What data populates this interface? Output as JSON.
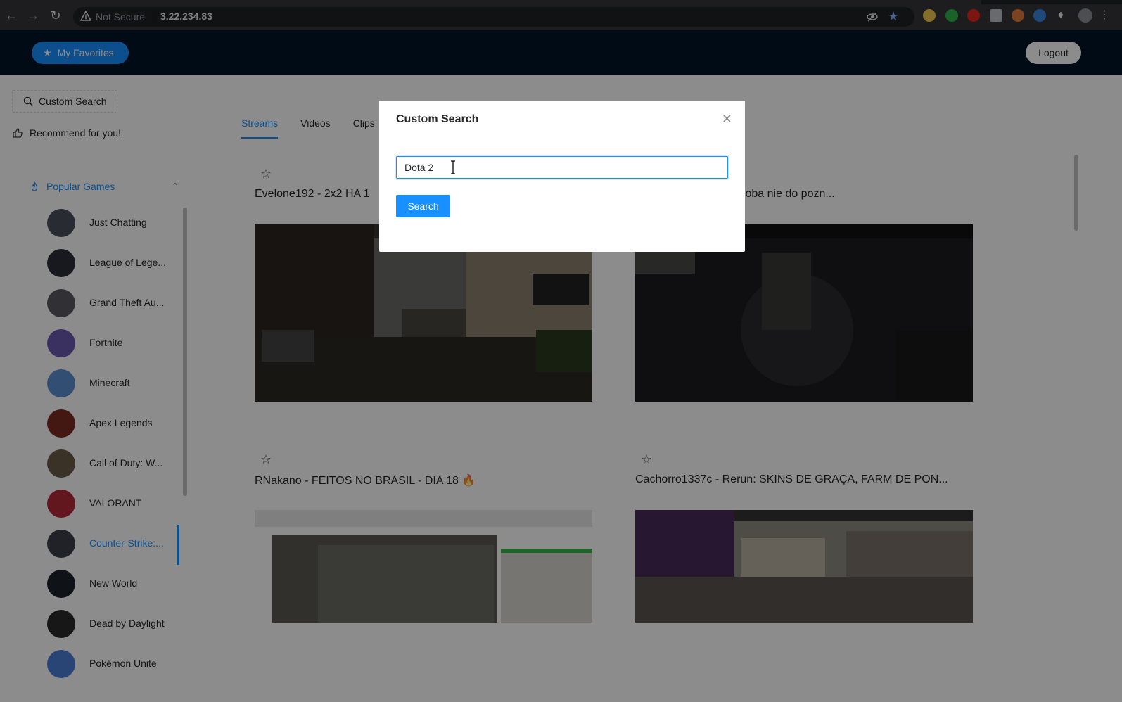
{
  "browser": {
    "not_secure": "Not Secure",
    "url": "3.22.234.83"
  },
  "header": {
    "favorites_label": "My Favorites",
    "logout_label": "Logout"
  },
  "sidebar": {
    "custom_search_label": "Custom Search",
    "recommend_label": "Recommend for you!",
    "popular_games_label": "Popular Games",
    "games": [
      {
        "name": "Just Chatting",
        "color": "#4b4f5c"
      },
      {
        "name": "League of Lege...",
        "color": "#2b2f3a"
      },
      {
        "name": "Grand Theft Au...",
        "color": "#5a5a62"
      },
      {
        "name": "Fortnite",
        "color": "#6b5ab0"
      },
      {
        "name": "Minecraft",
        "color": "#5b8fd0"
      },
      {
        "name": "Apex Legends",
        "color": "#7a2b22"
      },
      {
        "name": "Call of Duty: W...",
        "color": "#6a5a48"
      },
      {
        "name": "VALORANT",
        "color": "#b22b3a"
      },
      {
        "name": "Counter-Strike:...",
        "color": "#3b3f48"
      },
      {
        "name": "New World",
        "color": "#1d2128"
      },
      {
        "name": "Dead by Daylight",
        "color": "#2a2a2a"
      },
      {
        "name": "Pokémon Unite",
        "color": "#4a7fd8"
      }
    ],
    "active_game_index": 8
  },
  "main": {
    "tabs": [
      "Streams",
      "Videos",
      "Clips"
    ],
    "active_tab": "Streams",
    "cards": [
      {
        "title": "Evelone192 - 2x2 HA 1"
      },
      {
        "title": "icie nowy człowiek, osoba nie do pozn..."
      },
      {
        "title": "RNakano - FEITOS NO BRASIL - DIA 18 🔥"
      },
      {
        "title": "Cachorro1337c - Rerun: SKINS DE GRAÇA, FARM DE PON..."
      }
    ]
  },
  "modal": {
    "title": "Custom Search",
    "input_value": "Dota 2",
    "search_label": "Search"
  },
  "colors": {
    "primary": "#1890ff",
    "header_bg": "#001529"
  }
}
